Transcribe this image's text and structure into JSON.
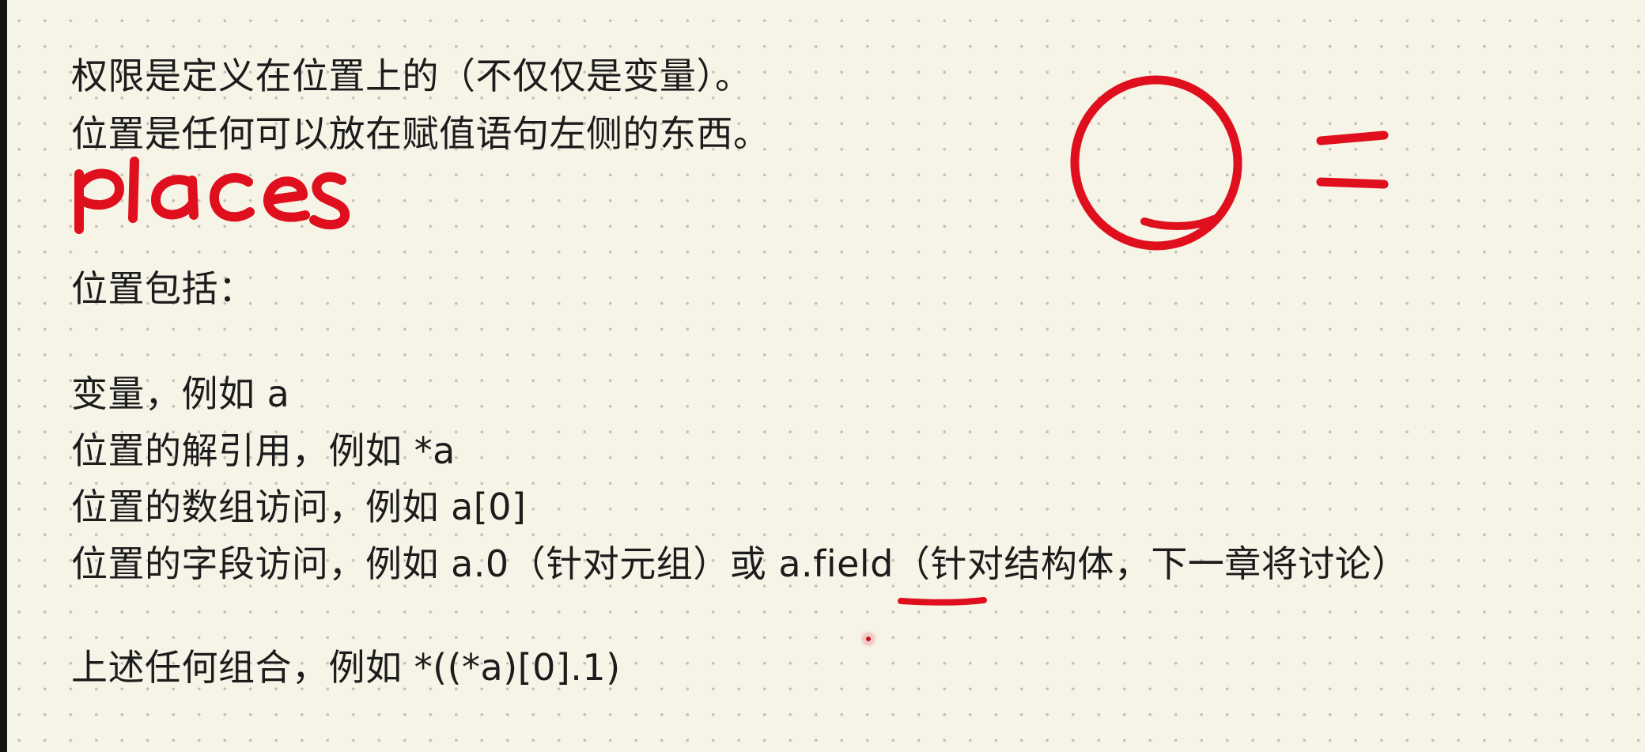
{
  "document": {
    "intro": [
      "权限是定义在位置上的（不仅仅是变量）。",
      "位置是任何可以放在赋值语句左侧的东西。"
    ],
    "includes_heading": "位置包括：",
    "items": [
      "变量，例如 a",
      "位置的解引用，例如 *a",
      "位置的数组访问，例如 a[0]",
      "位置的字段访问，例如 a.0（针对元组）或 a.field（针对结构体，下一章将讨论）"
    ],
    "combination": "上述任何组合，例如 *((*a)[0].1)"
  },
  "annotations": {
    "handwriting": "places",
    "ink_color": "#e00f1d"
  }
}
